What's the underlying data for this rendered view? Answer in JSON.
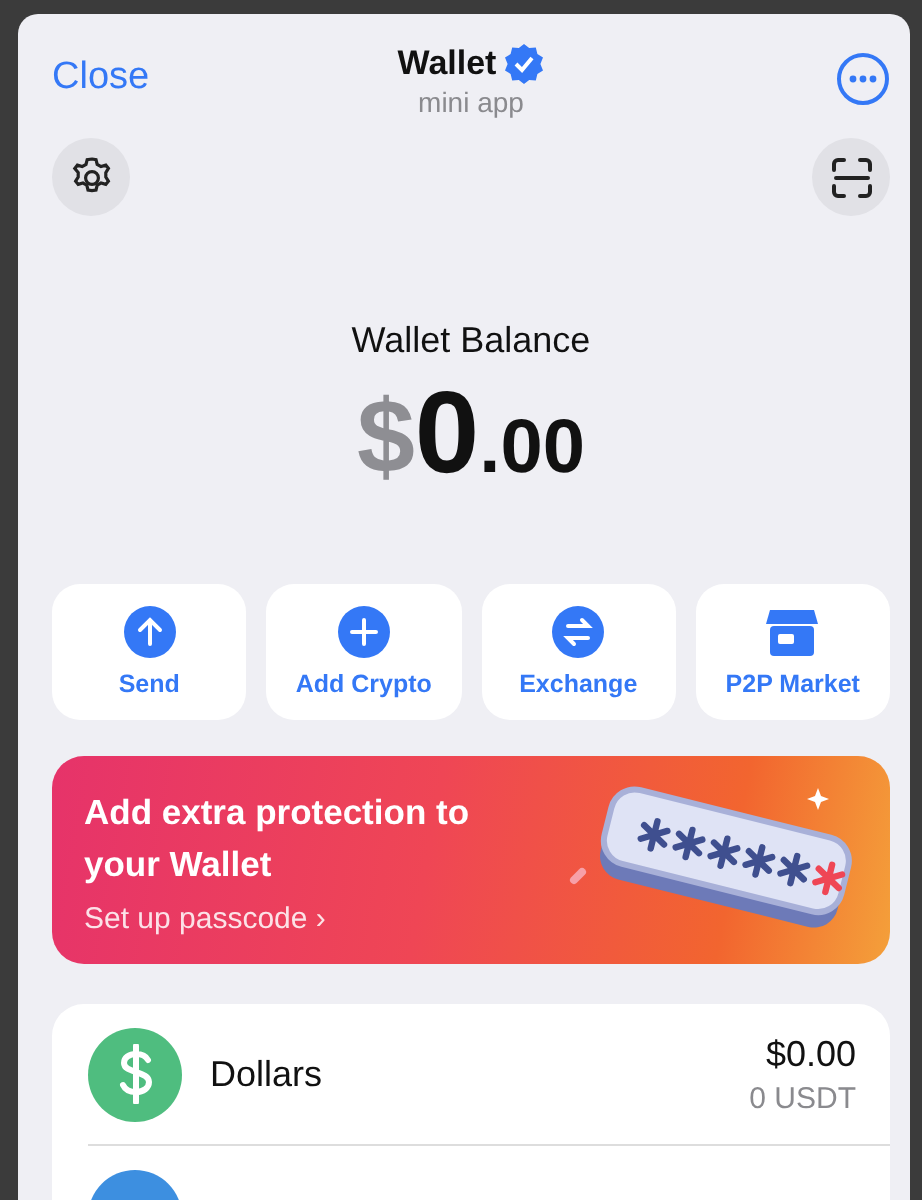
{
  "header": {
    "close": "Close",
    "title": "Wallet",
    "verified": true,
    "subtitle": "mini app"
  },
  "balance": {
    "label": "Wallet Balance",
    "currency": "$",
    "integer": "0",
    "fraction": ".00"
  },
  "actions": [
    {
      "kind": "send",
      "label": "Send"
    },
    {
      "kind": "add",
      "label": "Add Crypto"
    },
    {
      "kind": "exchange",
      "label": "Exchange"
    },
    {
      "kind": "market",
      "label": "P2P Market"
    }
  ],
  "banner": {
    "title": "Add extra protection to your Wallet",
    "link": "Set up passcode ›"
  },
  "assets": [
    {
      "kind": "dollar",
      "name": "Dollars",
      "amount": "$0.00",
      "sub": "0 USDT",
      "color": "#4fbd7f"
    },
    {
      "kind": "partial",
      "color": "#3d8fe0"
    }
  ]
}
